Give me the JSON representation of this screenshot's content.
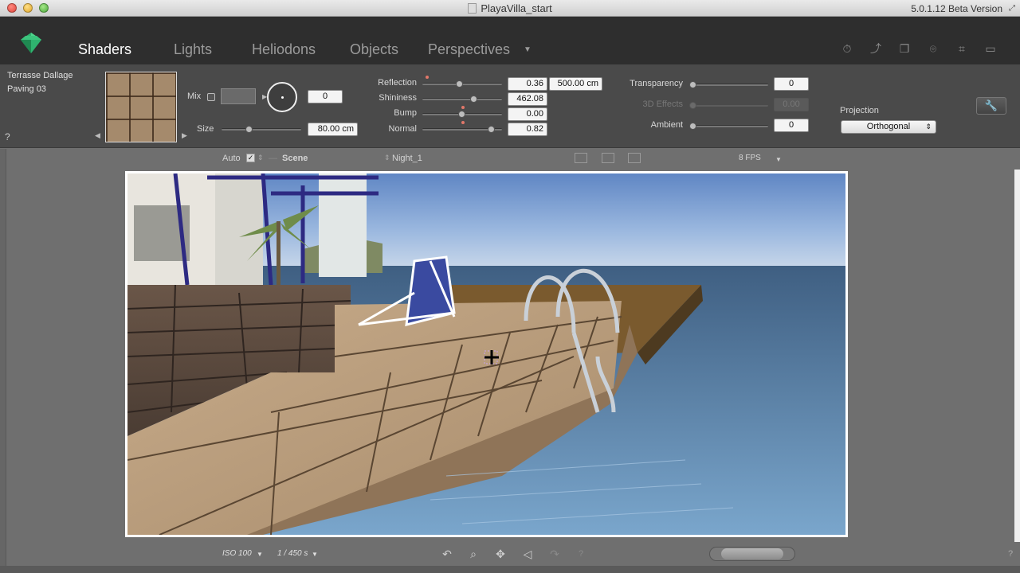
{
  "window": {
    "title": "PlayaVilla_start",
    "version": "5.0.1.12 Beta Version"
  },
  "tabs": [
    "Shaders",
    "Lights",
    "Heliodons",
    "Objects",
    "Perspectives"
  ],
  "active_tab": "Shaders",
  "material": {
    "name": "Terrasse Dallage",
    "sub": "Paving 03",
    "mix_label": "Mix",
    "mix_value": "0",
    "size_label": "Size",
    "size_value": "80.00 cm"
  },
  "properties": {
    "reflection_label": "Reflection",
    "reflection_value": "0.36",
    "reflection_distance": "500.00 cm",
    "shininess_label": "Shininess",
    "shininess_value": "462.08",
    "bump_label": "Bump",
    "bump_value": "0.00",
    "normal_label": "Normal",
    "normal_value": "0.82",
    "transparency_label": "Transparency",
    "transparency_value": "0",
    "effects3d_label": "3D Effects",
    "effects3d_value": "0.00",
    "ambient_label": "Ambient",
    "ambient_value": "0"
  },
  "projection": {
    "label": "Projection",
    "value": "Orthogonal"
  },
  "viewport_toolbar": {
    "auto_label": "Auto",
    "auto_checked": true,
    "scene_label": "Scene",
    "night_label": "Night_1",
    "fps_label": "8 FPS"
  },
  "bottom_bar": {
    "iso_label": "ISO 100",
    "shutter_label": "1 / 450 s"
  },
  "colors": {
    "tabbar_bg": "#2e2e2e",
    "panel_bg": "#4a4a4a",
    "accent_logo": "#2fb36f"
  },
  "icons": {
    "tool_icons": [
      "timer-icon",
      "axis-icon",
      "windows-icon",
      "camera-icon",
      "crop-icon",
      "display-icon"
    ],
    "nav_icons": [
      "rotate-icon",
      "zoom-icon",
      "pan-icon",
      "walk-icon",
      "redo-icon",
      "help-icon"
    ]
  }
}
